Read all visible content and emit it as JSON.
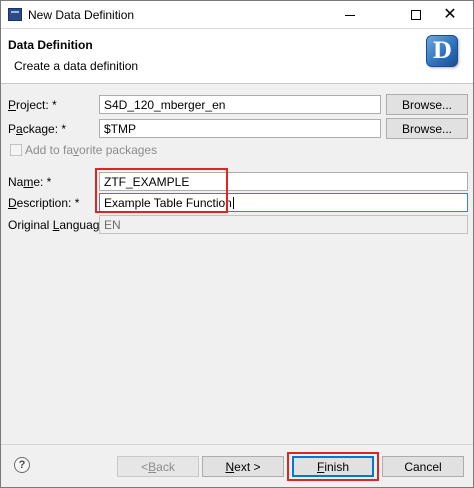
{
  "window": {
    "title": "New Data Definition",
    "icon": "wizard-app-icon"
  },
  "header": {
    "title": "Data Definition",
    "subtitle": "Create a data definition",
    "icon_letter": "D"
  },
  "form": {
    "project": {
      "label_underlined": "P",
      "label_rest": "roject: *",
      "value": "S4D_120_mberger_en",
      "button": "Browse..."
    },
    "package": {
      "label_pre": "P",
      "label_underlined": "a",
      "label_rest": "ckage: *",
      "value": "$TMP",
      "button": "Browse..."
    },
    "favorite": {
      "label_pre": "Add to fa",
      "label_underlined": "v",
      "label_rest": "orite packages",
      "checked": false
    },
    "name": {
      "label_pre": "Na",
      "label_underlined": "m",
      "label_rest": "e: *",
      "value": "ZTF_EXAMPLE"
    },
    "description": {
      "label_underlined": "D",
      "label_rest": "escription: *",
      "value": "Example Table Function"
    },
    "language": {
      "label_pre": "Original ",
      "label_underlined": "L",
      "label_rest": "anguage:",
      "value": "EN"
    }
  },
  "footer": {
    "help_glyph": "?",
    "back": {
      "pre": "< ",
      "underlined": "B",
      "rest": "ack"
    },
    "next": {
      "underlined": "N",
      "rest": "ext >"
    },
    "finish": {
      "underlined": "F",
      "rest": "inish"
    },
    "cancel": "Cancel"
  },
  "colors": {
    "highlight": "#e02424",
    "focus": "#3c7fd1",
    "default_button": "#0078d7"
  }
}
